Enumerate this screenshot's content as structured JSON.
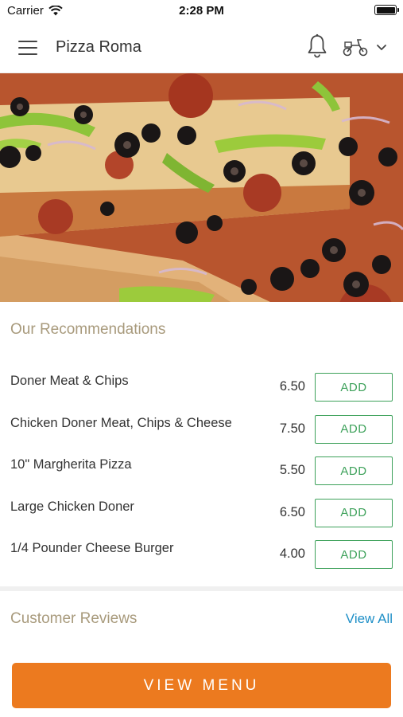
{
  "status_bar": {
    "carrier": "Carrier",
    "time": "2:28 PM",
    "icons": [
      "wifi-icon",
      "battery-icon"
    ]
  },
  "app_bar": {
    "title": "Pizza Roma",
    "icons": [
      "menu-icon",
      "bell-icon",
      "delivery-scooter-icon",
      "chevron-down-icon"
    ]
  },
  "hero": {
    "image": "pizza-slice-photo"
  },
  "recommendations": {
    "title": "Our Recommendations",
    "items": [
      {
        "name": "Doner Meat & Chips",
        "price": "6.50",
        "button": "ADD"
      },
      {
        "name": "Chicken Doner Meat, Chips & Cheese",
        "price": "7.50",
        "button": "ADD"
      },
      {
        "name": "10\" Margherita Pizza",
        "price": "5.50",
        "button": "ADD"
      },
      {
        "name": "Large Chicken Doner",
        "price": "6.50",
        "button": "ADD"
      },
      {
        "name": "1/4 Pounder Cheese Burger",
        "price": "4.00",
        "button": "ADD"
      }
    ]
  },
  "reviews": {
    "title": "Customer Reviews",
    "view_all": "View All"
  },
  "footer": {
    "view_menu": "VIEW MENU"
  },
  "colors": {
    "accent_orange": "#ec7a1f",
    "add_green": "#3da15a",
    "link_blue": "#1e8fc7",
    "section_title": "#a89a7c"
  }
}
